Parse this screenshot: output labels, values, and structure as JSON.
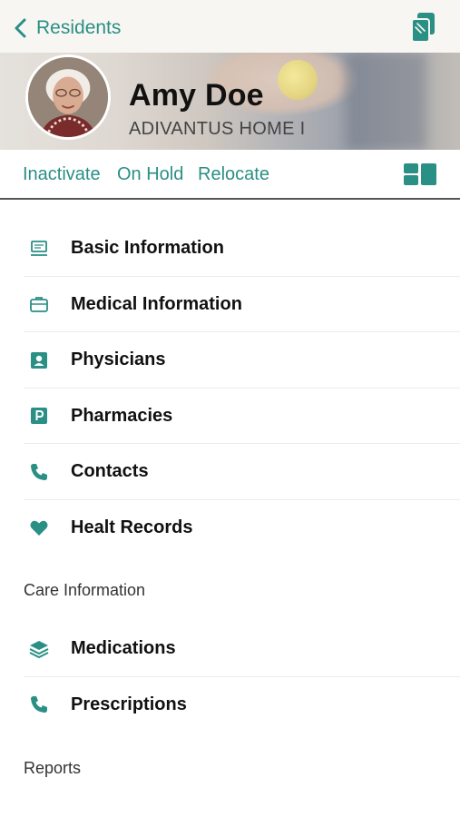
{
  "nav": {
    "back_label": "Residents"
  },
  "resident": {
    "name": "Amy Doe",
    "facility": "ADIVANTUS HOME I"
  },
  "actions": {
    "inactivate": "Inactivate",
    "on_hold": "On Hold",
    "relocate": "Relocate"
  },
  "menu_items": [
    {
      "label": "Basic Information",
      "icon": "laptop-icon"
    },
    {
      "label": "Medical Information",
      "icon": "briefcase-icon"
    },
    {
      "label": "Physicians",
      "icon": "contact-card-icon"
    },
    {
      "label": "Pharmacies",
      "icon": "parking-icon"
    },
    {
      "label": "Contacts",
      "icon": "phone-icon"
    },
    {
      "label": "Healt Records",
      "icon": "heart-icon"
    }
  ],
  "sections": {
    "care_information": "Care Information",
    "reports": "Reports"
  },
  "care_items": [
    {
      "label": "Medications",
      "icon": "layers-icon"
    },
    {
      "label": "Prescriptions",
      "icon": "phone-icon"
    }
  ],
  "colors": {
    "accent": "#2a8f85",
    "text": "#111111"
  }
}
